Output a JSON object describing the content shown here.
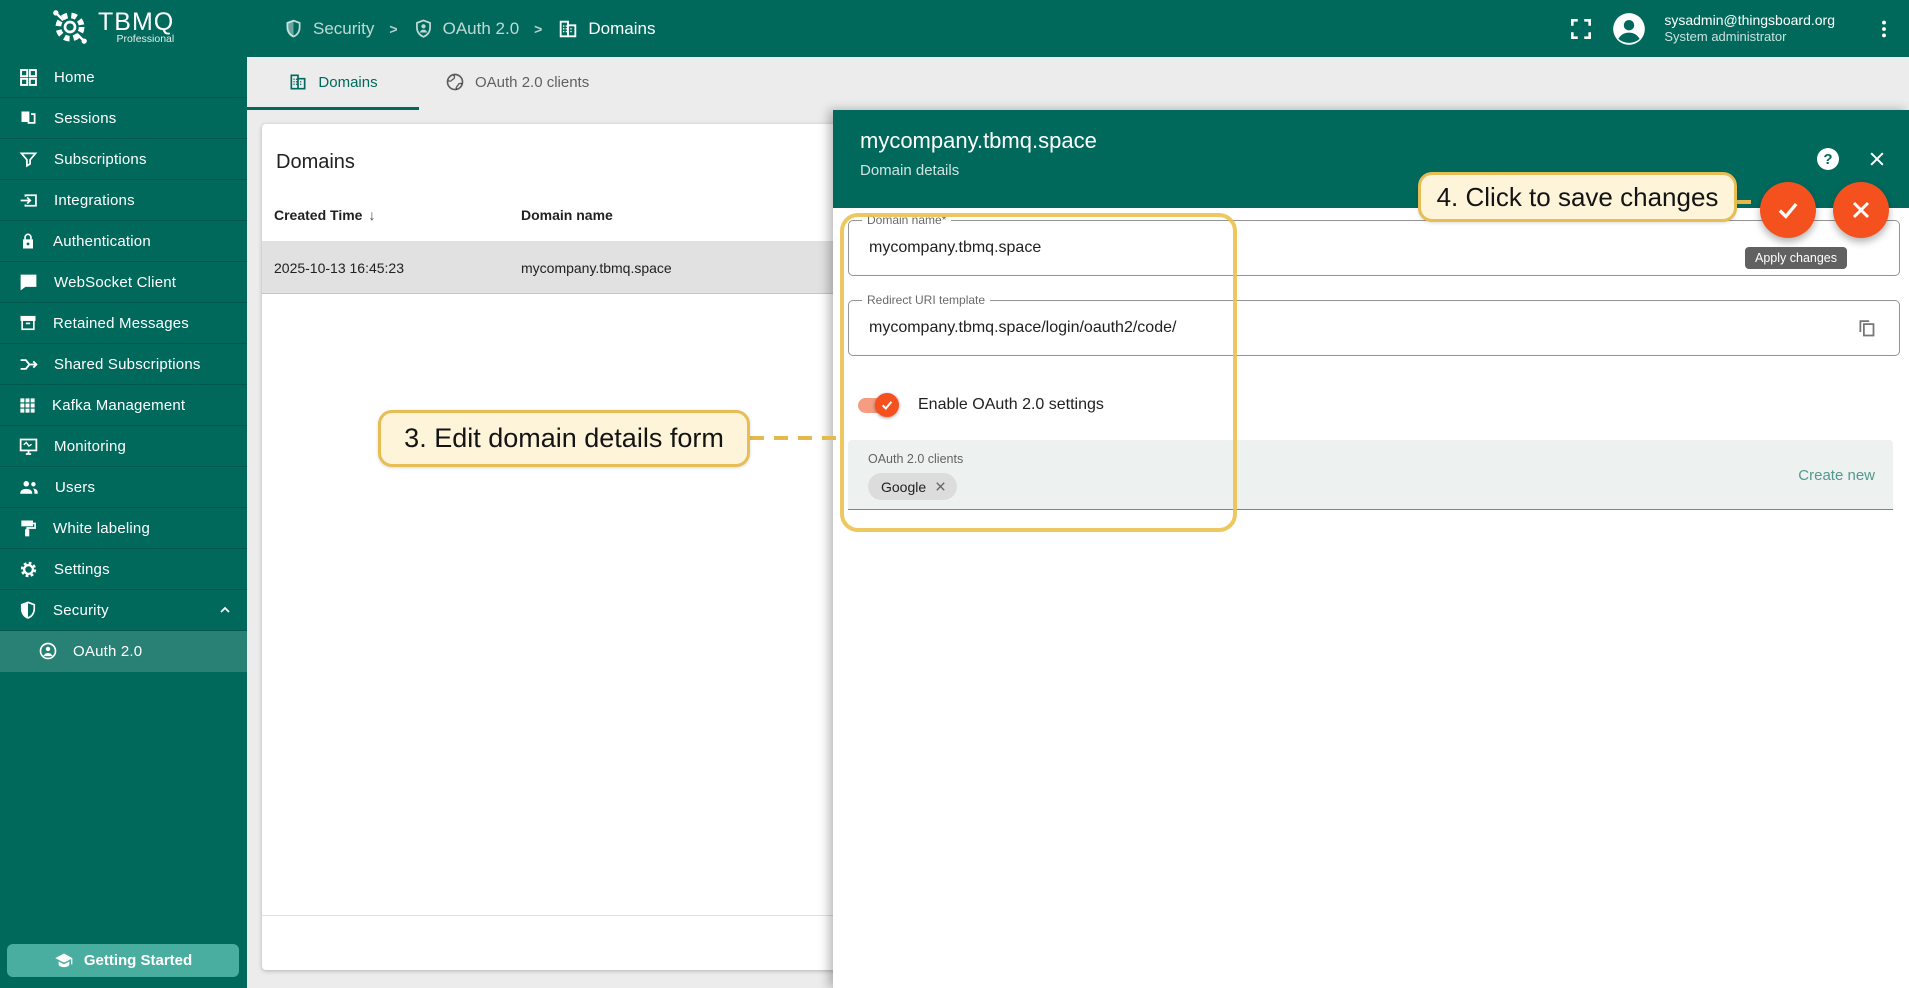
{
  "app": {
    "logo_title": "TBMQ",
    "logo_subtitle": "Professional"
  },
  "topbar": {
    "breadcrumb": {
      "separator": ">",
      "items": [
        {
          "label": "Security",
          "icon": "shield-icon"
        },
        {
          "label": "OAuth 2.0",
          "icon": "oauth-shield-icon"
        },
        {
          "label": "Domains",
          "icon": "domain-icon"
        }
      ]
    },
    "user_email": "sysadmin@thingsboard.org",
    "user_role": "System administrator"
  },
  "sidebar": {
    "items": [
      {
        "label": "Home",
        "icon": "dashboard-icon"
      },
      {
        "label": "Sessions",
        "icon": "sessions-book-icon"
      },
      {
        "label": "Subscriptions",
        "icon": "filter-icon"
      },
      {
        "label": "Integrations",
        "icon": "input-icon"
      },
      {
        "label": "Authentication",
        "icon": "lock-icon"
      },
      {
        "label": "WebSocket Client",
        "icon": "chat-icon"
      },
      {
        "label": "Retained Messages",
        "icon": "archive-icon"
      },
      {
        "label": "Shared Subscriptions",
        "icon": "call-split-icon"
      },
      {
        "label": "Kafka Management",
        "icon": "grid-icon"
      },
      {
        "label": "Monitoring",
        "icon": "monitor-icon"
      },
      {
        "label": "Users",
        "icon": "people-icon"
      },
      {
        "label": "White labeling",
        "icon": "format-paint-icon"
      },
      {
        "label": "Settings",
        "icon": "gear-icon"
      },
      {
        "label": "Security",
        "icon": "security-shield-icon"
      }
    ],
    "security_sub_item": {
      "label": "OAuth 2.0",
      "icon": "oauth-person-icon"
    },
    "getting_started": "Getting Started"
  },
  "tabs": [
    {
      "label": "Domains",
      "icon": "domain-icon",
      "active": true
    },
    {
      "label": "OAuth 2.0 clients",
      "icon": "globe-icon",
      "active": false
    }
  ],
  "table": {
    "title": "Domains",
    "columns": [
      "Created Time",
      "Domain name"
    ],
    "sort_glyph": "↓",
    "rows": [
      {
        "created_time": "2025-10-13 16:45:23",
        "domain_name": "mycompany.tbmq.space"
      }
    ]
  },
  "panel": {
    "title": "mycompany.tbmq.space",
    "subtitle": "Domain details",
    "help_glyph": "?",
    "apply_tooltip": "Apply changes",
    "fields": [
      {
        "label": "Domain name*",
        "value": "mycompany.tbmq.space"
      },
      {
        "label": "Redirect URI template",
        "value": "mycompany.tbmq.space/login/oauth2/code/"
      }
    ],
    "toggle": {
      "label": "Enable OAuth 2.0 settings",
      "state": "on"
    },
    "clients": {
      "label": "OAuth 2.0 clients",
      "chips": [
        "Google"
      ],
      "create_new_label": "Create new"
    }
  },
  "annotations": {
    "step3": "3. Edit domain details form",
    "step4": "4. Click to save changes"
  },
  "colors": {
    "primary_teal": "#00695c",
    "accent_orange": "#f4511e",
    "sidebar_active_bg": "rgba(255,255,255,0.16)",
    "annotation_border": "#e7bd55",
    "annotation_bg": "#fdf4da",
    "selected_row_bg": "#e1e1e1",
    "tooltip_bg": "#616161",
    "getting_started_bg": "#49ae9f"
  }
}
